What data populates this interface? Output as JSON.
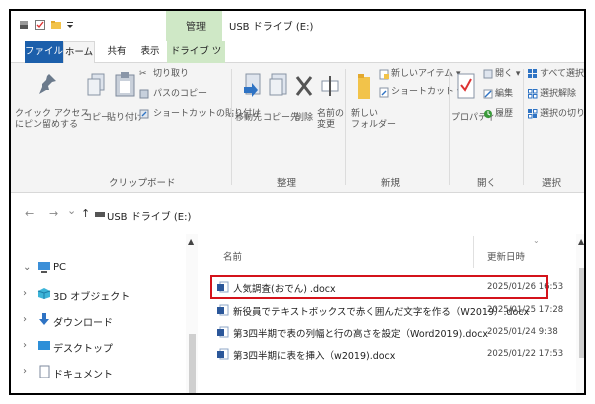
{
  "qat": {
    "icons": [
      "disk-icon",
      "checkbox-icon",
      "folder-icon",
      "dropdown-icon"
    ]
  },
  "window": {
    "context_label": "管理",
    "title": "USB ドライブ (E:)"
  },
  "tabs": [
    {
      "label": "ファイル"
    },
    {
      "label": "ホーム"
    },
    {
      "label": "共有"
    },
    {
      "label": "表示"
    },
    {
      "label": "ドライブ ツール"
    }
  ],
  "ribbon": {
    "clipboard": {
      "pin_label_1": "クイック アクセス",
      "pin_label_2": "にピン留めする",
      "copy": "コピー",
      "paste": "貼り付け",
      "cut": "切り取り",
      "copy_path": "パスのコピー",
      "paste_shortcut": "ショートカットの貼り付け",
      "group": "クリップボード"
    },
    "organize": {
      "move_to": "移動先",
      "copy_to": "コピー先",
      "delete": "削除",
      "rename_1": "名前の",
      "rename_2": "変更",
      "group": "整理"
    },
    "new": {
      "new_item": "新しいアイテム ▾",
      "shortcut": "ショートカット ▾",
      "new_folder_1": "新しい",
      "new_folder_2": "フォルダー",
      "group": "新規"
    },
    "open": {
      "properties": "プロパティ",
      "open_item": "開く ▾",
      "edit": "編集",
      "history": "履歴",
      "group": "開く"
    },
    "select": {
      "select_all": "すべて選択",
      "select_none": "選択解除",
      "invert": "選択の切り替え",
      "group": "選択"
    }
  },
  "address": {
    "back": "←",
    "forward": "→",
    "recent": "⌄",
    "up": "↑",
    "path": "USB ドライブ (E:)"
  },
  "nav_pane": {
    "items": [
      {
        "label": "PC",
        "chevron": "⌄"
      },
      {
        "label": "3D オブジェクト",
        "chevron": "›"
      },
      {
        "label": "ダウンロード",
        "chevron": "›"
      },
      {
        "label": "デスクトップ",
        "chevron": "›"
      },
      {
        "label": "ドキュメント",
        "chevron": "›"
      }
    ]
  },
  "file_list": {
    "col_name": "名前",
    "col_date": "更新日時",
    "files": [
      {
        "name": "人気調査(おでん) .docx",
        "date": "2025/01/26 16:53"
      },
      {
        "name": "新役員でテキストボックスで赤く囲んだ文字を作る（W2019）.docx",
        "date": "2025/01/25 17:28"
      },
      {
        "name": "第3四半期で表の列幅と行の高さを設定（Word2019).docx",
        "date": "2025/01/24 9:38"
      },
      {
        "name": "第3四半期に表を挿入（w2019).docx",
        "date": "2025/01/22 17:53"
      }
    ]
  },
  "colors": {
    "file_tab": "#1c5fab",
    "context_green": "#cfe8c6",
    "highlight": "#d4131b"
  }
}
